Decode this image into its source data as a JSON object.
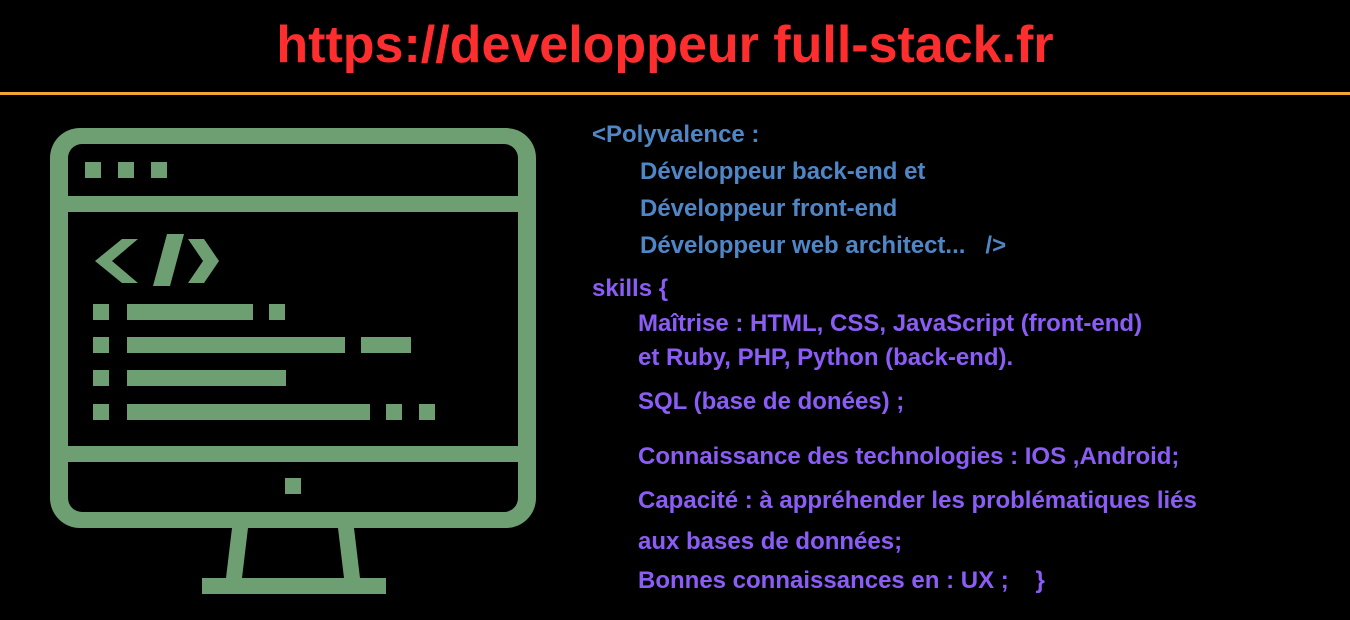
{
  "header": {
    "title": "https://developpeur full-stack.fr"
  },
  "polyvalence": {
    "line1": "<Polyvalence :",
    "line2": "Développeur back-end et",
    "line3": "Développeur front-end",
    "line4": "Développeur web architect...   />"
  },
  "skills": {
    "open": "skills {",
    "line1": "Maîtrise : HTML, CSS, JavaScript (front-end)",
    "line2": "et Ruby, PHP, Python (back-end).",
    "line3": "SQL (base de donées) ;",
    "line4": "Connaissance des technologies : IOS ,Android;",
    "line5": "Capacité : à appréhender les problématiques liés",
    "line6": "aux bases de données;",
    "line7": "Bonnes connaissances en : UX ;    }"
  },
  "colors": {
    "title": "#ff2e2e",
    "divider": "#f0a733",
    "monitor": "#6e9f72",
    "polyvalence_text": "#4f86c6",
    "skills_text": "#8b5cf6",
    "background": "#000000"
  },
  "icons": {
    "monitor": "code-monitor-icon"
  }
}
